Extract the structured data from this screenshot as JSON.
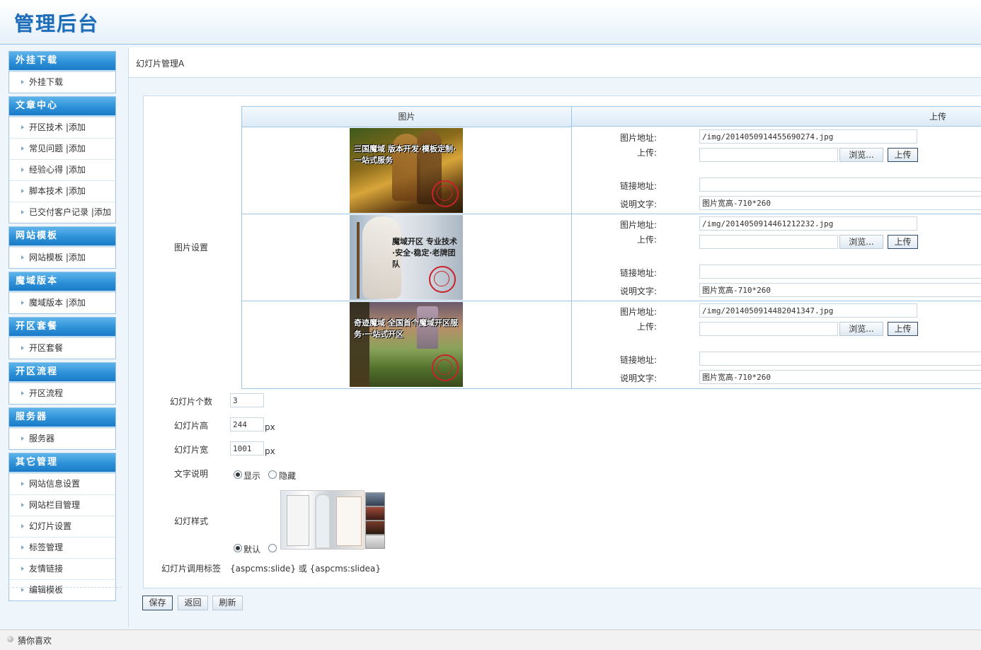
{
  "header": {
    "brand": "管理后台"
  },
  "sidebar": {
    "groups": [
      {
        "title": "外挂下载",
        "items": [
          "外挂下载"
        ]
      },
      {
        "title": "文章中心",
        "items": [
          "开区技术 |添加",
          "常见问题 |添加",
          "经验心得 |添加",
          "脚本技术 |添加",
          "已交付客户记录 |添加"
        ]
      },
      {
        "title": "网站模板",
        "items": [
          "网站模板 |添加"
        ]
      },
      {
        "title": "魔域版本",
        "items": [
          "魔域版本 |添加"
        ]
      },
      {
        "title": "开区套餐",
        "items": [
          "开区套餐"
        ]
      },
      {
        "title": "开区流程",
        "items": [
          "开区流程"
        ]
      },
      {
        "title": "服务器",
        "items": [
          "服务器"
        ]
      },
      {
        "title": "其它管理",
        "items": [
          "网站信息设置",
          "网站栏目管理",
          "幻灯片设置",
          "标签管理",
          "友情链接",
          "编辑模板"
        ]
      }
    ]
  },
  "page": {
    "title": "幻灯片管理A"
  },
  "image_settings": {
    "label": "图片设置",
    "col_image": "图片",
    "col_upload": "上传",
    "field_labels": {
      "image_url": "图片地址:",
      "upload": "上传:",
      "link_url": "链接地址:",
      "caption": "说明文字:"
    },
    "browse_label": "浏览...",
    "upload_label": "上传",
    "slides": [
      {
        "image_url": "/img/2014050914455690274.jpg",
        "link_url": "",
        "caption": "图片宽高-710*260",
        "thumb_text": "三国魔域 版本开发·模板定制·一站式服务"
      },
      {
        "image_url": "/img/2014050914461212232.jpg",
        "link_url": "",
        "caption": "图片宽高-710*260",
        "thumb_text": "魔域开区 专业技术·安全·稳定·老牌团队"
      },
      {
        "image_url": "/img/2014050914482041347.jpg",
        "link_url": "",
        "caption": "图片宽高-710*260",
        "thumb_text": "奇迹魔域 全国首个魔域开区服务·一站式开区"
      }
    ]
  },
  "settings": {
    "count_label": "幻灯片个数",
    "count_value": "3",
    "height_label": "幻灯片高",
    "height_value": "244",
    "width_label": "幻灯片宽",
    "width_value": "1001",
    "unit": "px",
    "caption_label": "文字说明",
    "caption_show": "显示",
    "caption_hide": "隐藏",
    "style_label": "幻灯样式",
    "style_default": "默认",
    "tag_label": "幻灯片调用标签",
    "tag_value": "{aspcms:slide} 或 {aspcms:slidea}"
  },
  "actions": {
    "save": "保存",
    "back": "返回",
    "refresh": "刷新"
  },
  "footer": {
    "text": "猜你喜欢"
  },
  "colors": {
    "brand": "#1f6db8",
    "menu_header": "#2a8ed6",
    "border": "#9ec5e6"
  }
}
